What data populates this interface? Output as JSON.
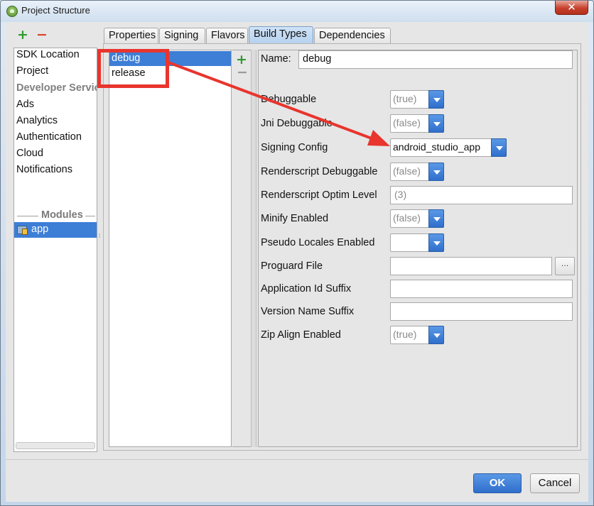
{
  "window": {
    "title": "Project Structure",
    "close_glyph": "✕"
  },
  "toolbar": {
    "add_glyph": "+",
    "remove_glyph": "−"
  },
  "left_panel": {
    "items": [
      {
        "label": "SDK Location",
        "selected": false
      },
      {
        "label": "Project",
        "selected": false
      }
    ],
    "developer_services_header": "Developer Services",
    "service_items": [
      "Ads",
      "Analytics",
      "Authentication",
      "Cloud",
      "Notifications"
    ],
    "modules_header": "Modules",
    "modules": [
      {
        "label": "app",
        "selected": true,
        "icon": "module-icon"
      }
    ]
  },
  "tabs": [
    {
      "label": "Properties",
      "active": false
    },
    {
      "label": "Signing",
      "active": false
    },
    {
      "label": "Flavors",
      "active": false
    },
    {
      "label": "Build Types",
      "active": true
    },
    {
      "label": "Dependencies",
      "active": false
    }
  ],
  "build_types": {
    "items": [
      {
        "label": "debug",
        "selected": true
      },
      {
        "label": "release",
        "selected": false
      }
    ],
    "add_glyph": "+",
    "remove_glyph": "−"
  },
  "properties": {
    "name_label": "Name:",
    "name_value": "debug",
    "rows": [
      {
        "label": "Debuggable",
        "type": "combo",
        "value": "(true)"
      },
      {
        "label": "Jni Debuggable",
        "type": "combo",
        "value": "(false)"
      },
      {
        "label": "Signing Config",
        "type": "combo",
        "value": "android_studio_app"
      },
      {
        "label": "Renderscript Debuggable",
        "type": "combo",
        "value": "(false)"
      },
      {
        "label": "Renderscript Optim Level",
        "type": "text",
        "value": "(3)"
      },
      {
        "label": "Minify Enabled",
        "type": "combo",
        "value": "(false)"
      },
      {
        "label": "Pseudo Locales Enabled",
        "type": "combo",
        "value": ""
      },
      {
        "label": "Proguard File",
        "type": "file",
        "value": "",
        "browse_label": "..."
      },
      {
        "label": "Application Id Suffix",
        "type": "text",
        "value": ""
      },
      {
        "label": "Version Name Suffix",
        "type": "text",
        "value": ""
      },
      {
        "label": "Zip Align Enabled",
        "type": "combo",
        "value": "(true)"
      }
    ]
  },
  "footer": {
    "ok_label": "OK",
    "cancel_label": "Cancel"
  },
  "colors": {
    "selection": "#3d7ed6",
    "annotation": "#e8352e",
    "add_green": "#2e9b2e",
    "remove_red": "#d9442b"
  }
}
